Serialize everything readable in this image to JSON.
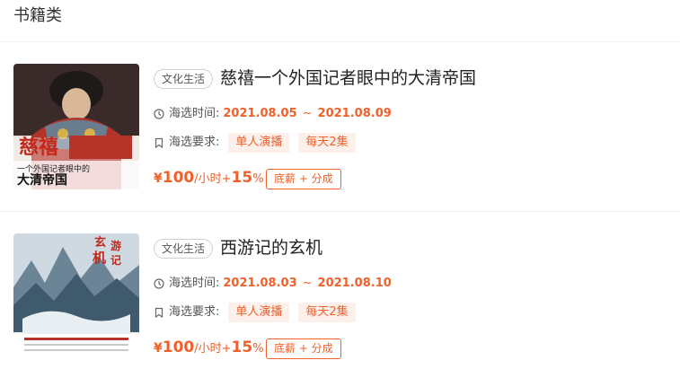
{
  "section": {
    "title": "书籍类"
  },
  "colors": {
    "accent": "#f0602a",
    "accent_bg": "#fdf0ea",
    "divider": "#f0f0f0"
  },
  "books": [
    {
      "category": "文化生活",
      "title": "慈禧一个外国记者眼中的大清帝国",
      "cover_icon": "book-cover-cixi",
      "date_label": "海选时间:",
      "date_start": "2021.08.05",
      "date_sep": "~",
      "date_end": "2021.08.09",
      "req_label": "海选要求:",
      "requirements": [
        "单人演播",
        "每天2集"
      ],
      "currency": "¥",
      "price": "100",
      "price_unit": "/小时+",
      "share": "15",
      "share_unit": "%",
      "pay_type": "底薪 + 分成"
    },
    {
      "category": "文化生活",
      "title": "西游记的玄机",
      "cover_icon": "book-cover-xiyouji",
      "date_label": "海选时间:",
      "date_start": "2021.08.03",
      "date_sep": "~",
      "date_end": "2021.08.10",
      "req_label": "海选要求:",
      "requirements": [
        "单人演播",
        "每天2集"
      ],
      "currency": "¥",
      "price": "100",
      "price_unit": "/小时+",
      "share": "15",
      "share_unit": "%",
      "pay_type": "底薪 + 分成"
    }
  ]
}
